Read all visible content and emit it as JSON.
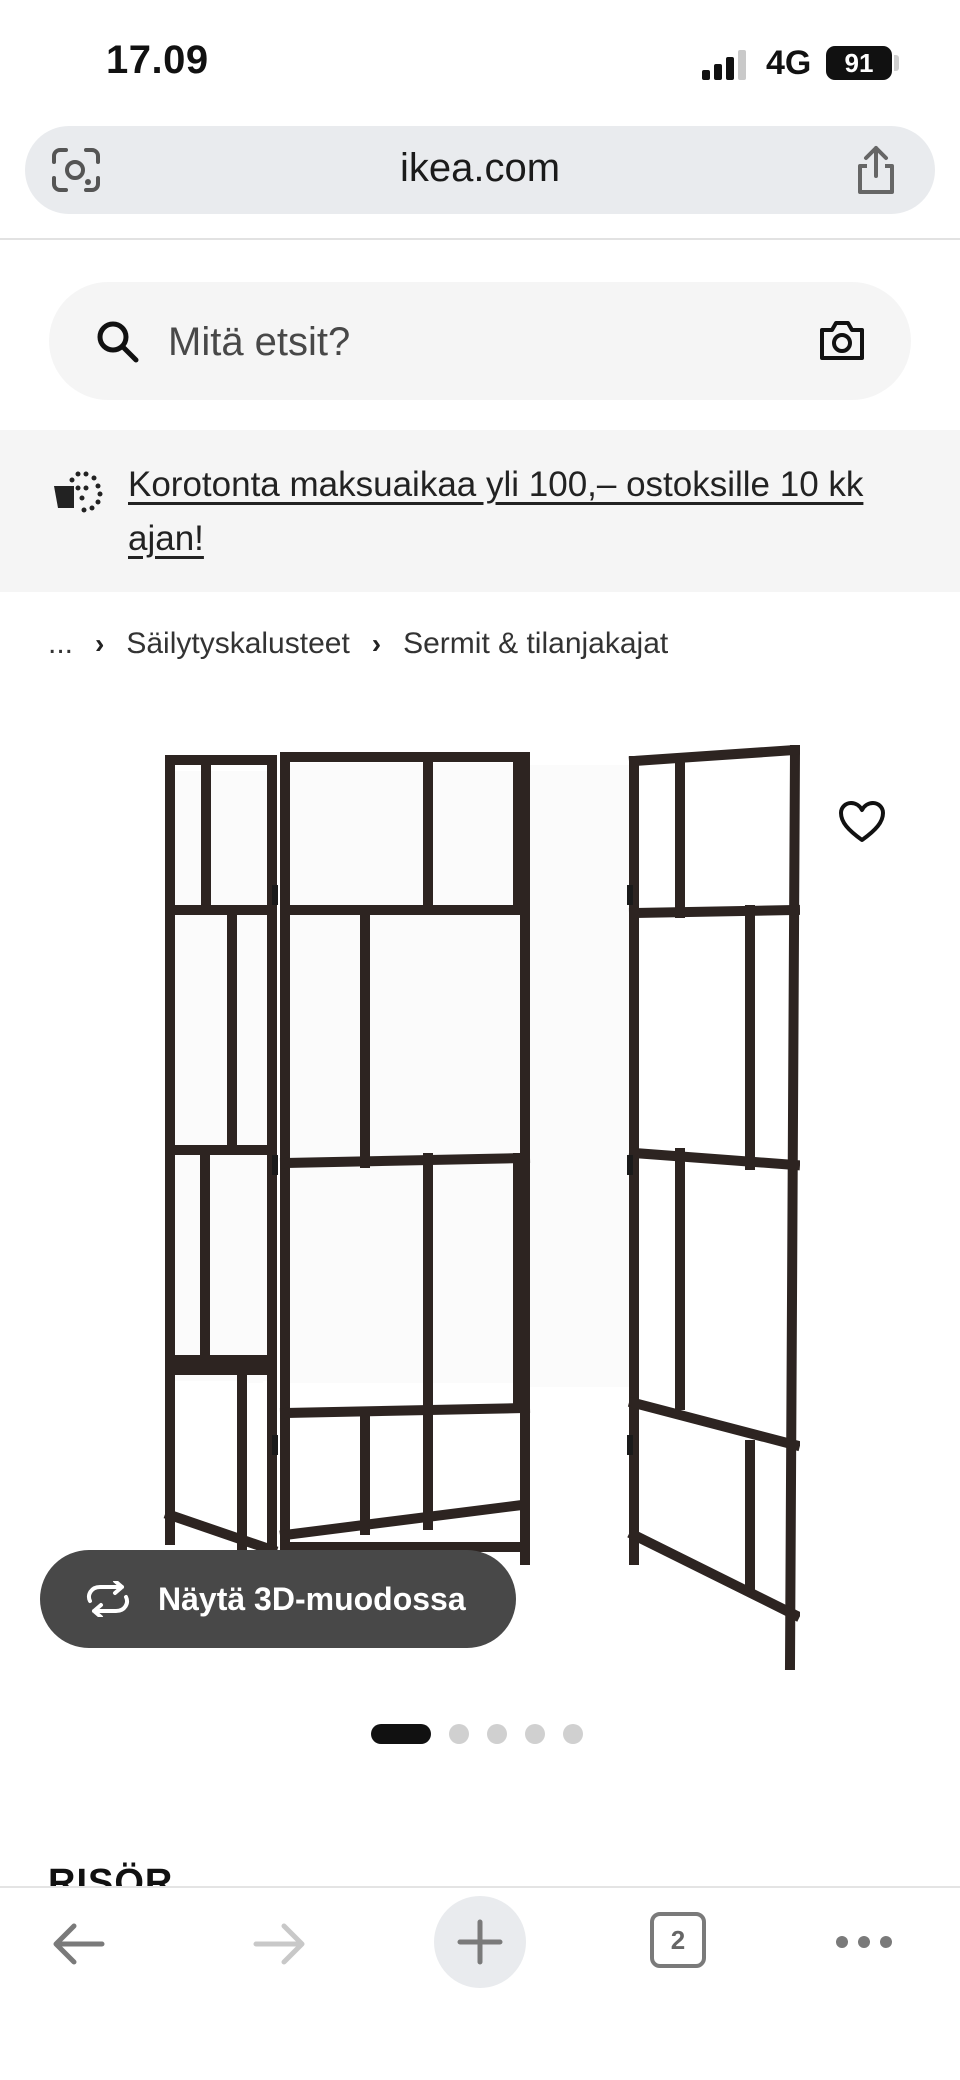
{
  "status_bar": {
    "time": "17.09",
    "network": "4G",
    "battery": "91"
  },
  "browser": {
    "url": "ikea.com",
    "tab_count": "2"
  },
  "search": {
    "placeholder": "Mitä etsit?"
  },
  "promo": {
    "text": "Korotonta maksuaikaa yli 100,– ostoksille 10 kk ajan!"
  },
  "breadcrumb": {
    "items": [
      "...",
      "Säilytyskalusteet",
      "Sermit & tilanjakajat"
    ]
  },
  "product": {
    "view_3d_label": "Näytä 3D-muodossa",
    "name": "RISÖR",
    "image_count": 5,
    "active_image": 1
  },
  "icons": {
    "lens": "google-lens-icon",
    "share": "share-icon",
    "search": "search-icon",
    "camera": "camera-icon",
    "promo": "payment-installment-icon",
    "favorite": "heart-icon",
    "rotate": "rotate-3d-icon",
    "back": "arrow-left-icon",
    "forward": "arrow-right-icon",
    "new_tab": "plus-icon",
    "more": "more-icon"
  }
}
